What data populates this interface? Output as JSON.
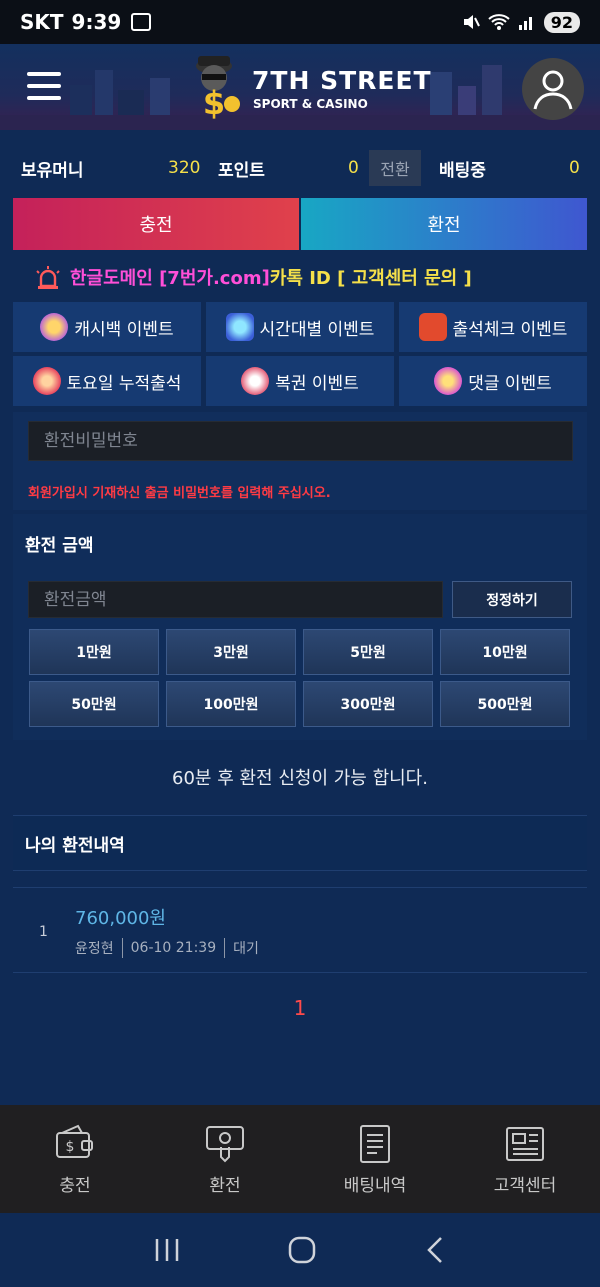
{
  "status_bar": {
    "carrier": "SKT",
    "time": "9:39",
    "battery": "92"
  },
  "header": {
    "logo_title": "7TH STREET",
    "logo_subtitle": "SPORT & CASINO"
  },
  "balance": {
    "money_label": "보유머니",
    "money_value": "320",
    "point_label": "포인트",
    "point_value": "0",
    "convert_label": "전환",
    "betting_label": "배팅중",
    "betting_value": "0"
  },
  "actions": {
    "charge_label": "충전",
    "exchange_label": "환전"
  },
  "notice": {
    "part1": "한글도메인 [ ",
    "part2": "7번가.com",
    "part3": " ] ",
    "part4": "카톡 ID [ 고객센터 문의 ]"
  },
  "events": [
    {
      "label": "캐시백 이벤트"
    },
    {
      "label": "시간대별 이벤트"
    },
    {
      "label": "출석체크 이벤트"
    },
    {
      "label": "토요일 누적출석"
    },
    {
      "label": "복권 이벤트"
    },
    {
      "label": "댓글 이벤트"
    }
  ],
  "password": {
    "placeholder": "환전비밀번호",
    "help": "회원가입시 기재하신 출금 비밀번호를 입력해 주십시오."
  },
  "amount": {
    "title": "환전 금액",
    "placeholder": "환전금액",
    "reset_label": "정정하기",
    "presets": [
      "1만원",
      "3만원",
      "5만원",
      "10만원",
      "50만원",
      "100만원",
      "300만원",
      "500만원"
    ]
  },
  "wait_message": "60분 후 환전 신청이 가능 합니다.",
  "history": {
    "title": "나의 환전내역",
    "rows": [
      {
        "no": "1",
        "amount": "760,000원",
        "name": "윤정현",
        "datetime": "06-10 21:39",
        "status": "대기"
      }
    ],
    "page": "1"
  },
  "bottom_nav": [
    {
      "label": "충전",
      "icon": "wallet-icon"
    },
    {
      "label": "환전",
      "icon": "exchange-icon"
    },
    {
      "label": "배팅내역",
      "icon": "document-icon"
    },
    {
      "label": "고객센터",
      "icon": "newspaper-icon"
    }
  ]
}
